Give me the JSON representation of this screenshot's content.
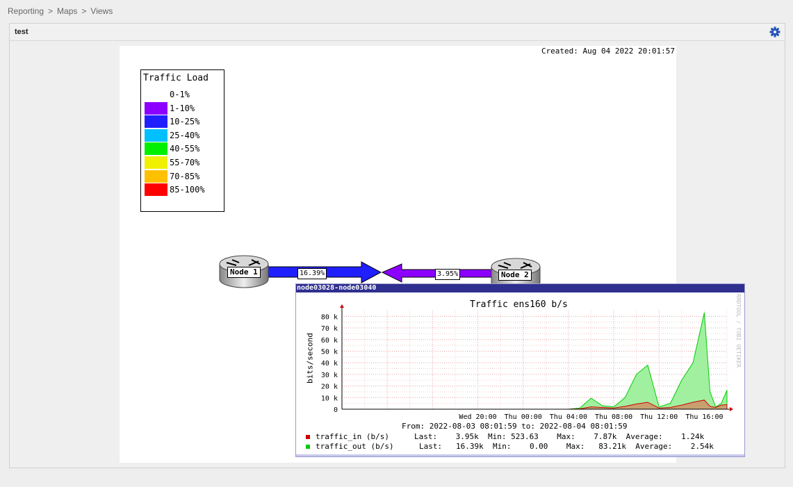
{
  "breadcrumb": {
    "items": [
      "Reporting",
      "Maps",
      "Views"
    ],
    "separator": ">"
  },
  "panel": {
    "title": "test",
    "settings_icon": "gear-icon",
    "accent": "#2050b8"
  },
  "map": {
    "created": "Created: Aug 04 2022 20:01:57",
    "legend": {
      "title": "Traffic Load",
      "rows": [
        {
          "label": "0-1%",
          "color": "#ffffff"
        },
        {
          "label": "1-10%",
          "color": "#8c00ff"
        },
        {
          "label": "10-25%",
          "color": "#2020ff"
        },
        {
          "label": "25-40%",
          "color": "#00c0ff"
        },
        {
          "label": "40-55%",
          "color": "#00f000"
        },
        {
          "label": "55-70%",
          "color": "#f0f000"
        },
        {
          "label": "70-85%",
          "color": "#ffc000"
        },
        {
          "label": "85-100%",
          "color": "#ff0000"
        }
      ]
    },
    "nodes": [
      {
        "label": "Node 1",
        "icon": "router-icon"
      },
      {
        "label": "Node 2",
        "icon": "router-icon"
      }
    ],
    "links": [
      {
        "label": "16.39%",
        "color": "#2020ff"
      },
      {
        "label": "3.95%",
        "color": "#8c00ff"
      }
    ]
  },
  "popup": {
    "title": "node03028-node03040",
    "graph_title": "Traffic ens160 b/s",
    "ylabel": "bits/second",
    "watermark": "RRDTOOL / TOBI OETIKER",
    "from_to": "From: 2022-08-03 08:01:59 to: 2022-08-04 08:01:59",
    "legend": [
      {
        "name": "traffic_in (b/s)",
        "color": "#cc0000",
        "stats": "Last:    3.95k  Min: 523.63    Max:    7.87k  Average:    1.24k"
      },
      {
        "name": "traffic_out (b/s)",
        "color": "#00cc00",
        "stats": "Last:   16.39k  Min:    0.00    Max:   83.21k  Average:    2.54k"
      }
    ]
  },
  "chart_data": {
    "type": "area",
    "title": "Traffic ens160 b/s",
    "ylabel": "bits/second",
    "xlabel": "",
    "ylim": [
      0,
      85000
    ],
    "yticks": [
      "0",
      "10 k",
      "20 k",
      "30 k",
      "40 k",
      "50 k",
      "60 k",
      "70 k",
      "80 k"
    ],
    "xticks": [
      "Wed 20:00",
      "Thu 00:00",
      "Thu 04:00",
      "Thu 08:00",
      "Thu 12:00",
      "Thu 16:00"
    ],
    "x_hours": [
      0,
      4,
      8,
      12,
      16,
      20,
      21,
      22,
      23,
      24,
      25,
      26,
      27,
      28,
      29,
      30,
      31,
      32,
      32.5,
      33,
      33.5,
      34
    ],
    "series": [
      {
        "name": "traffic_in (b/s)",
        "color": "#cc0000",
        "values": [
          0,
          0,
          0,
          0,
          0,
          0,
          300,
          2000,
          1500,
          1000,
          2500,
          4500,
          6000,
          1000,
          1500,
          3500,
          6000,
          7870,
          2500,
          1500,
          3500,
          3950
        ]
      },
      {
        "name": "traffic_out (b/s)",
        "color": "#00cc00",
        "values": [
          0,
          0,
          0,
          0,
          0,
          0,
          1000,
          9500,
          3000,
          2000,
          10000,
          30000,
          38000,
          2000,
          5000,
          25000,
          40000,
          83210,
          15000,
          2000,
          5000,
          16390
        ]
      }
    ],
    "grid": true,
    "legend": "bottom"
  }
}
